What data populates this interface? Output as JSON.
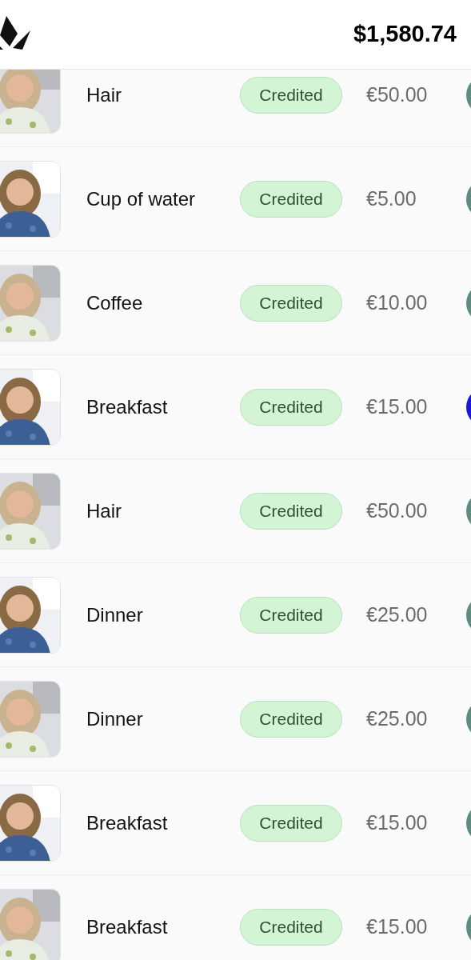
{
  "header": {
    "balance": "$1,580.74"
  },
  "transactions": [
    {
      "description": "Hair",
      "status": "Credited",
      "amount": "€50.00",
      "color": "#5e8d7f"
    },
    {
      "description": "Cup of water",
      "status": "Credited",
      "amount": "€5.00",
      "color": "#5e8d7f"
    },
    {
      "description": "Coffee",
      "status": "Credited",
      "amount": "€10.00",
      "color": "#5e8d7f"
    },
    {
      "description": "Breakfast",
      "status": "Credited",
      "amount": "€15.00",
      "color": "#1a17d8"
    },
    {
      "description": "Hair",
      "status": "Credited",
      "amount": "€50.00",
      "color": "#5e8d7f"
    },
    {
      "description": "Dinner",
      "status": "Credited",
      "amount": "€25.00",
      "color": "#5e8d7f"
    },
    {
      "description": "Dinner",
      "status": "Credited",
      "amount": "€25.00",
      "color": "#5e8d7f"
    },
    {
      "description": "Breakfast",
      "status": "Credited",
      "amount": "€15.00",
      "color": "#5e8d7f"
    },
    {
      "description": "Breakfast",
      "status": "Credited",
      "amount": "€15.00",
      "color": "#5e8d7f"
    }
  ]
}
